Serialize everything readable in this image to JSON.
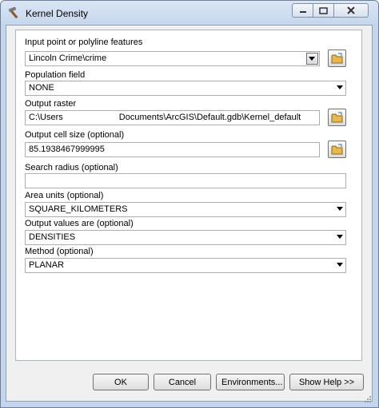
{
  "window": {
    "title": "Kernel Density"
  },
  "fields": {
    "input_features": {
      "label": "Input point or polyline features",
      "value": "Lincoln Crime\\crime"
    },
    "population_field": {
      "label": "Population field",
      "value": "NONE"
    },
    "output_raster": {
      "label": "Output raster",
      "value_prefix": "C:\\Users",
      "value_suffix": "Documents\\ArcGIS\\Default.gdb\\Kernel_default"
    },
    "cell_size": {
      "label": "Output cell size (optional)",
      "value": "85.1938467999995"
    },
    "search_radius": {
      "label": "Search radius (optional)",
      "value": ""
    },
    "area_units": {
      "label": "Area units (optional)",
      "value": "SQUARE_KILOMETERS"
    },
    "output_values": {
      "label": "Output values are (optional)",
      "value": "DENSITIES"
    },
    "method": {
      "label": "Method (optional)",
      "value": "PLANAR"
    }
  },
  "buttons": {
    "ok": "OK",
    "cancel": "Cancel",
    "environments": "Environments...",
    "show_help": "Show Help >>"
  },
  "icons": {
    "title": "hammer-icon",
    "browse": "open-folder-icon"
  }
}
